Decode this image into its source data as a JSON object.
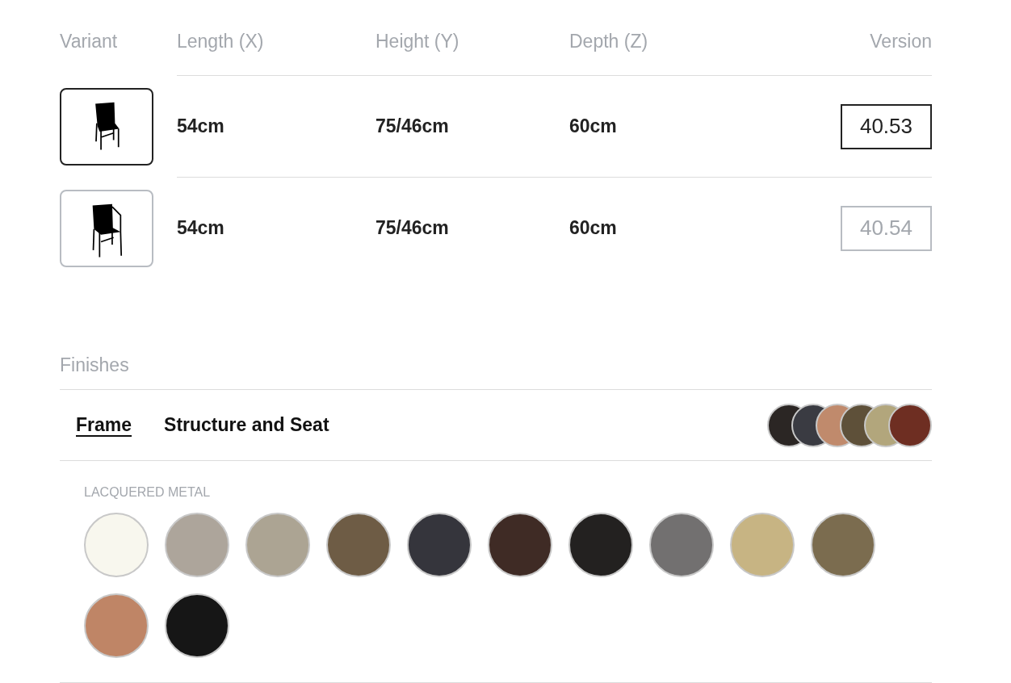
{
  "variants_table": {
    "columns": [
      "Variant",
      "Length (X)",
      "Height (Y)",
      "Depth (Z)",
      "Version"
    ],
    "rows": [
      {
        "kind": "chair",
        "length": "54cm",
        "height": "75/46cm",
        "depth": "60cm",
        "version": "40.53",
        "selected": true
      },
      {
        "kind": "armchair",
        "length": "54cm",
        "height": "75/46cm",
        "depth": "60cm",
        "version": "40.54",
        "selected": false
      }
    ]
  },
  "finishes": {
    "title": "Finishes",
    "tabs": [
      {
        "label": "Frame",
        "selected": true
      },
      {
        "label": "Structure and Seat",
        "selected": false
      }
    ],
    "preview_swatches": [
      {
        "color": "#2b2624"
      },
      {
        "color": "#3a3b42"
      },
      {
        "color": "#c08a6c"
      },
      {
        "color": "#5e5039"
      },
      {
        "color": "#b2a67c"
      },
      {
        "color": "#6e2e22"
      }
    ],
    "group": {
      "title": "LACQUERED METAL",
      "swatches": [
        {
          "color": "#f8f7ee"
        },
        {
          "color": "#ada59b"
        },
        {
          "color": "#aca493"
        },
        {
          "color": "#6e5c45"
        },
        {
          "color": "#35353c"
        },
        {
          "color": "#3f2b25"
        },
        {
          "color": "#232120"
        },
        {
          "color": "#727070"
        },
        {
          "color": "#c7b483"
        },
        {
          "color": "#7b6c4f"
        },
        {
          "color": "#bf8566"
        },
        {
          "color": "#161616"
        }
      ]
    }
  }
}
